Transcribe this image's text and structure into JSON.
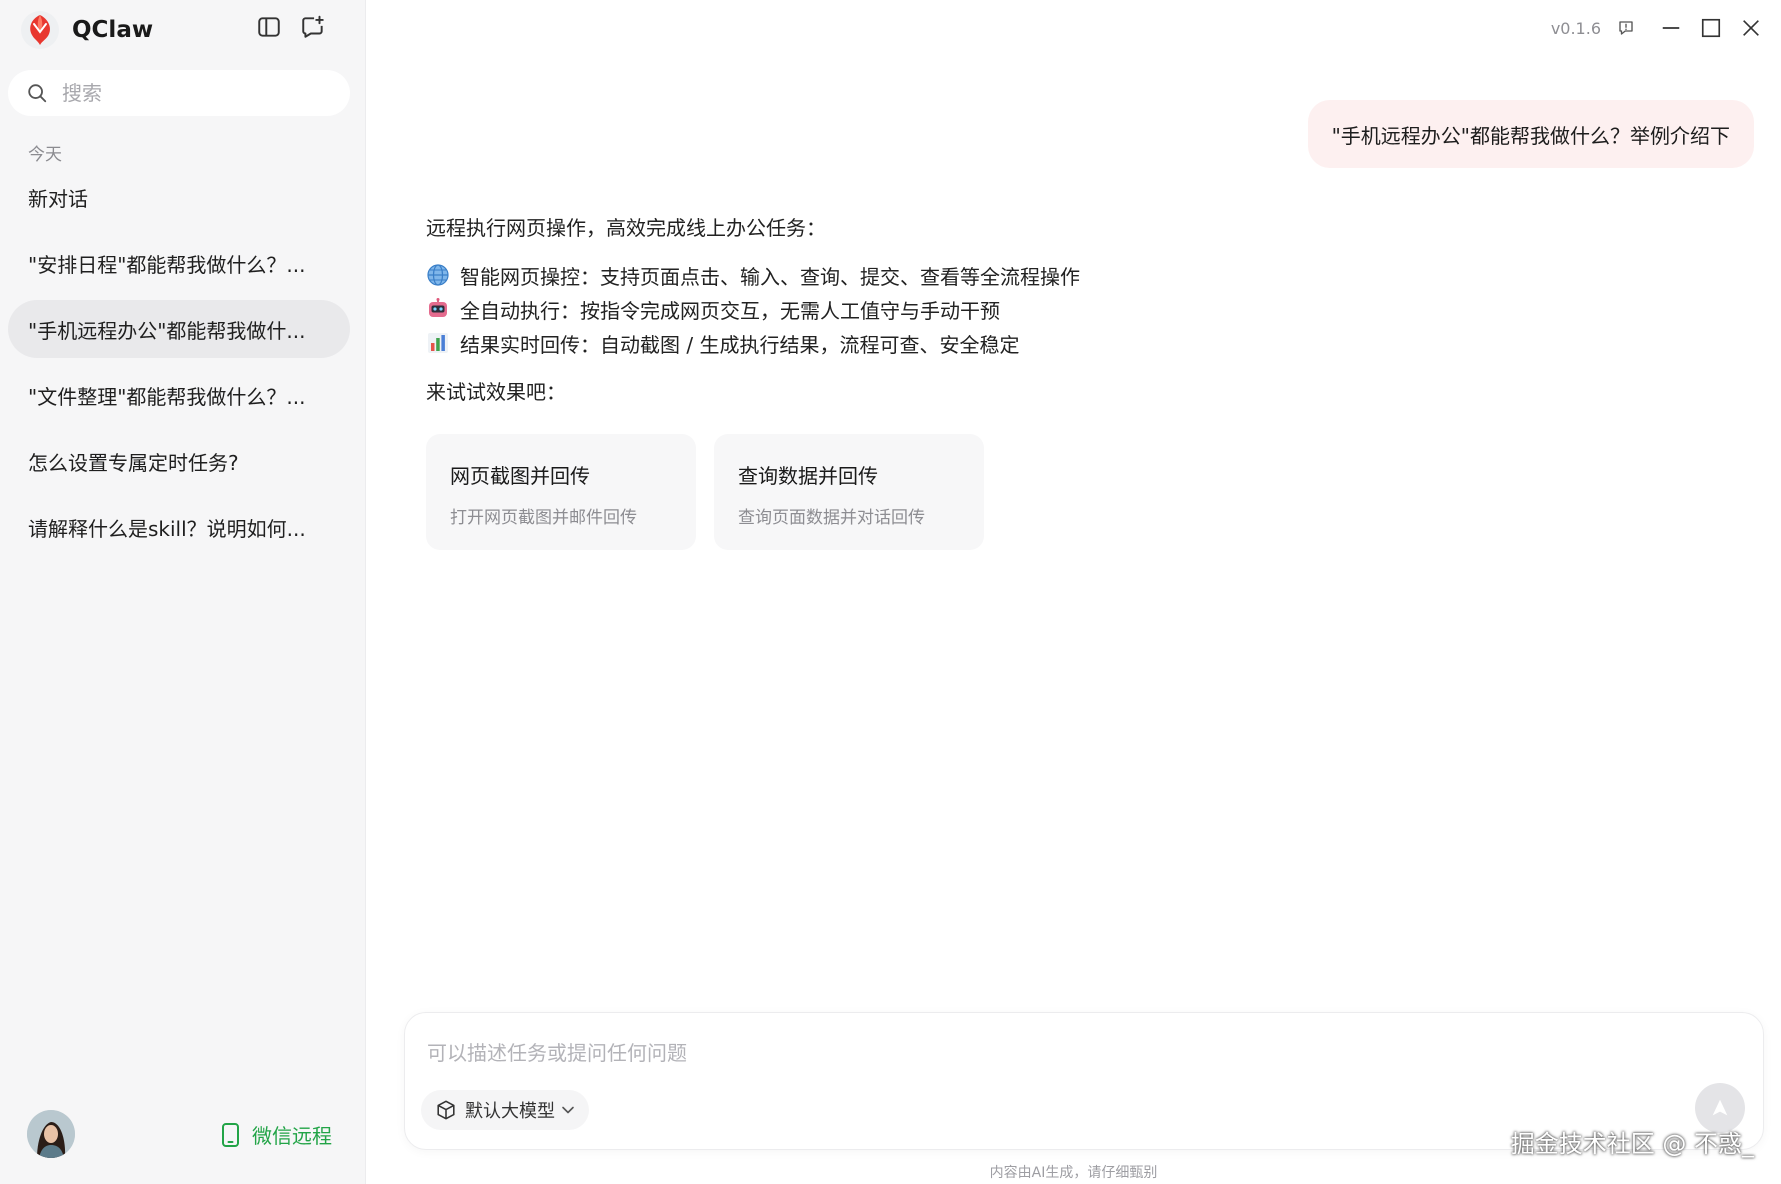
{
  "app": {
    "name": "QClaw",
    "version": "v0.1.6"
  },
  "sidebar": {
    "search_placeholder": "搜索",
    "section_label": "今天",
    "conversations": [
      {
        "label": "新对话"
      },
      {
        "label": "\"安排日程\"都能帮我做什么？..."
      },
      {
        "label": "\"手机远程办公\"都能帮我做什...",
        "active": true
      },
      {
        "label": "\"文件整理\"都能帮我做什么？..."
      },
      {
        "label": "怎么设置专属定时任务?"
      },
      {
        "label": "请解释什么是skill？说明如何..."
      }
    ],
    "wechat_remote_label": "微信远程"
  },
  "chat": {
    "user_message": "\"手机远程办公\"都能帮我做什么？举例介绍下",
    "reply_intro": "远程执行网页操作，高效完成线上办公任务：",
    "reply_items": [
      {
        "icon": "globe-icon",
        "text": "智能网页操控：支持页面点击、输入、查询、提交、查看等全流程操作"
      },
      {
        "icon": "robot-icon",
        "text": "全自动执行：按指令完成网页交互，无需人工值守与手动干预"
      },
      {
        "icon": "bar-chart-icon",
        "text": "结果实时回传：自动截图 / 生成执行结果，流程可查、安全稳定"
      }
    ],
    "try_label": "来试试效果吧：",
    "suggestions": [
      {
        "title": "网页截图并回传",
        "subtitle": "打开网页截图并邮件回传"
      },
      {
        "title": "查询数据并回传",
        "subtitle": "查询页面数据并对话回传"
      }
    ]
  },
  "composer": {
    "placeholder": "可以描述任务或提问任何问题",
    "model_label": "默认大模型"
  },
  "footer": {
    "disclaimer": "内容由AI生成，请仔细甄别",
    "watermark": "掘金技术社区 @ 不惑_"
  },
  "colors": {
    "accent_green": "#22a447",
    "user_bubble_bg": "#fdf0f0",
    "sidebar_bg": "#f6f6f7",
    "active_item_bg": "#e9e9eb"
  }
}
